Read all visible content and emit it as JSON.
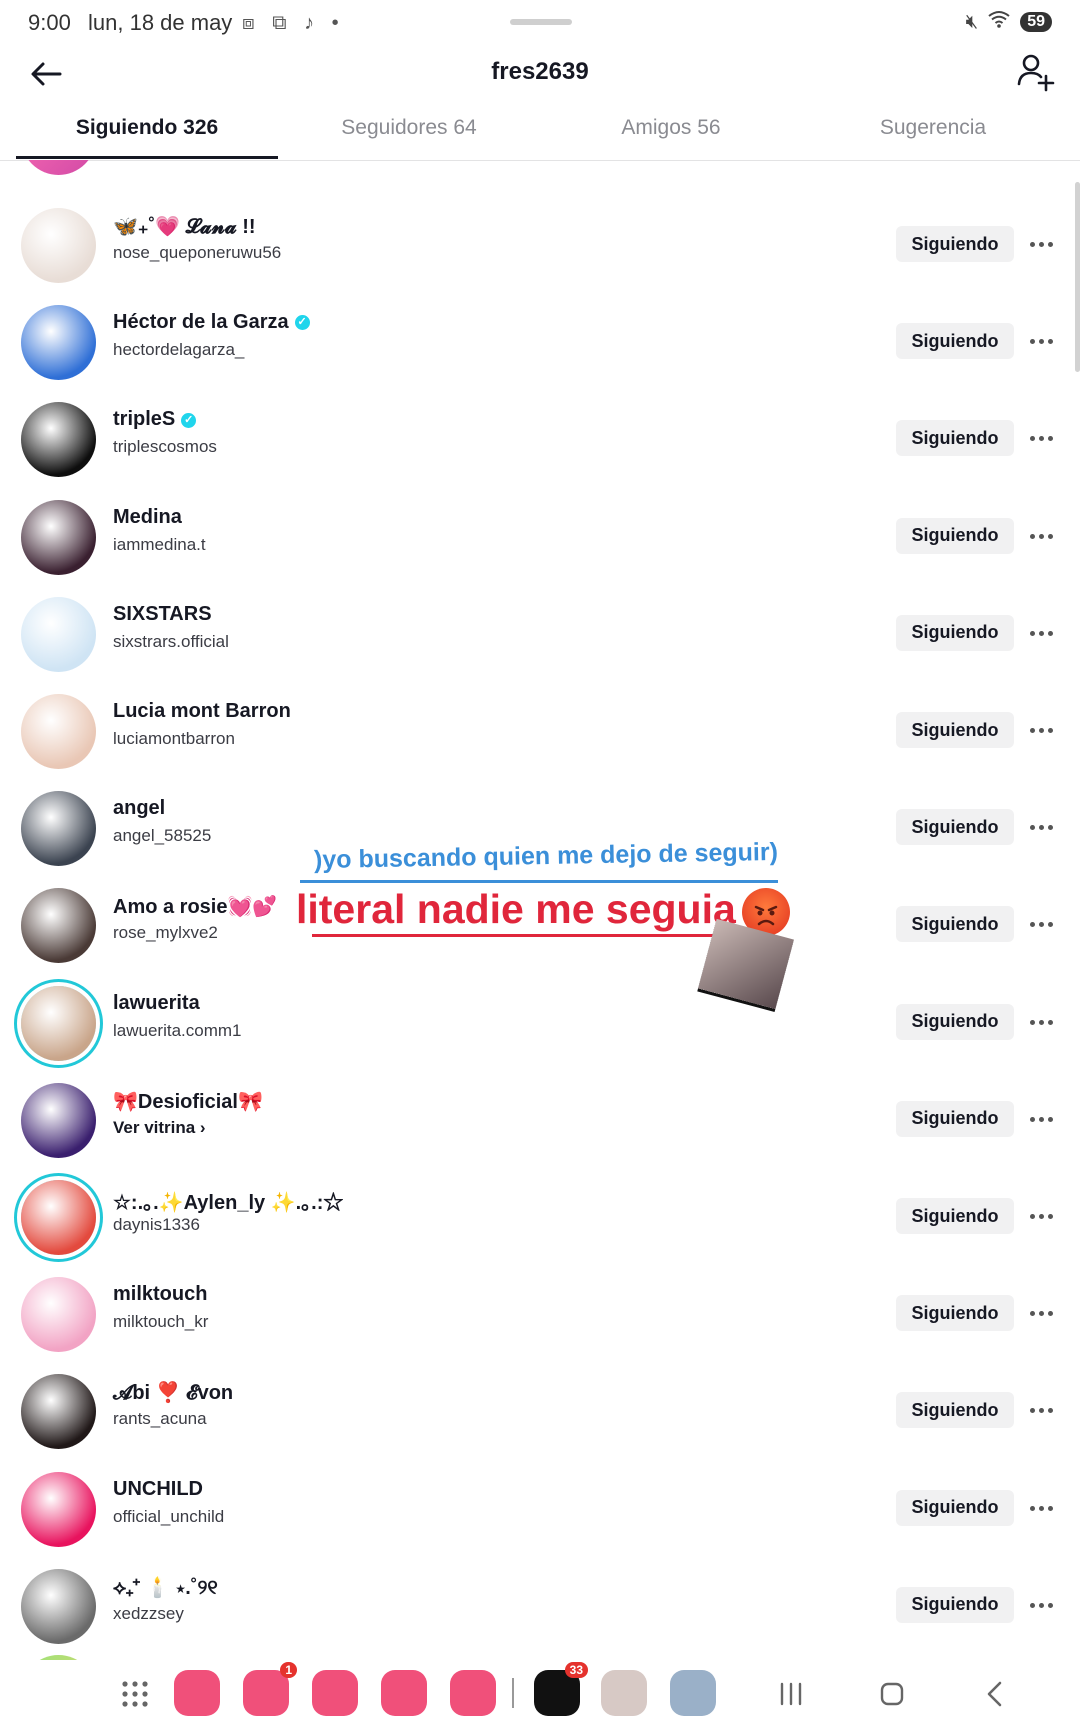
{
  "status_bar": {
    "time": "9:00",
    "date": "lun, 18 de may",
    "battery": "59"
  },
  "header": {
    "title": "fres2639"
  },
  "tabs": [
    {
      "label": "Siguiendo 326"
    },
    {
      "label": "Seguidores 64"
    },
    {
      "label": "Amigos 56"
    },
    {
      "label": "Sugerencia"
    }
  ],
  "follow_button_label": "Siguiendo",
  "users": [
    {
      "name": "🦋₊˚💗 𝓛𝓪𝓷𝓪 !!",
      "username": "nose_queponeruwu56",
      "verified": false,
      "avatar_color": "#e8ddd6"
    },
    {
      "name": "Héctor de la Garza",
      "username": "hectordelagarza_",
      "verified": true,
      "avatar_color": "#2f6fd6"
    },
    {
      "name": "tripleS",
      "username": "triplescosmos",
      "verified": true,
      "avatar_color": "#0e0e0e"
    },
    {
      "name": "Medina",
      "username": "iammedina.t",
      "verified": false,
      "avatar_color": "#3a2030"
    },
    {
      "name": "SIXSTARS",
      "username": "sixstrars.official",
      "verified": false,
      "avatar_color": "#cfe4f4"
    },
    {
      "name": "Lucia mont Barron",
      "username": "luciamontbarron",
      "verified": false,
      "avatar_color": "#e9c7b5"
    },
    {
      "name": "angel",
      "username": "angel_58525",
      "verified": false,
      "avatar_color": "#3b4350"
    },
    {
      "name": "Amo a rosie💓💕",
      "username": "rose_mylxve2",
      "verified": false,
      "avatar_color": "#4a3a36"
    },
    {
      "name": "lawuerita",
      "username": "lawuerita.comm1",
      "verified": false,
      "avatar_color": "#c9a58a",
      "ring": true
    },
    {
      "name": "🎀Desioficial🎀",
      "username": "Ver vitrina ›",
      "verified": false,
      "avatar_color": "#3a1f6e",
      "bold_sub": true
    },
    {
      "name": "☆:.｡.✨Aylen_ly ✨.｡.:☆",
      "username": "daynis1336",
      "verified": false,
      "avatar_color": "#e34a3e",
      "ring": true
    },
    {
      "name": "milktouch",
      "username": "milktouch_kr",
      "verified": false,
      "avatar_color": "#f2a3c4"
    },
    {
      "name": "𝓐bi ❣️ 𝓔von",
      "username": "rants_acuna",
      "verified": false,
      "avatar_color": "#201818"
    },
    {
      "name": "UNCHILD",
      "username": "official_unchild",
      "verified": false,
      "avatar_color": "#e8135e"
    },
    {
      "name": "⟡₊⁺ 🕯️ ⋆.˚୨୧",
      "username": "xedzzsey",
      "verified": false,
      "avatar_color": "#6a6a6a"
    }
  ],
  "overlay": {
    "line1": ")yo buscando quien me dejo de seguir)",
    "line2": "literal nadie me seguia"
  },
  "dock": {
    "apps": [
      {
        "name": "notes",
        "color": "#f0507a"
      },
      {
        "name": "calendar",
        "color": "#f0507a",
        "badge": "1"
      },
      {
        "name": "messages",
        "color": "#f0507a"
      },
      {
        "name": "chrome",
        "color": "#f0507a"
      },
      {
        "name": "camera",
        "color": "#f0507a"
      },
      {
        "name": "tiktok",
        "color": "#111111",
        "badge": "33"
      },
      {
        "name": "app-eye",
        "color": "#d7c9c5"
      },
      {
        "name": "app-photo",
        "color": "#9ab0c8"
      }
    ]
  }
}
